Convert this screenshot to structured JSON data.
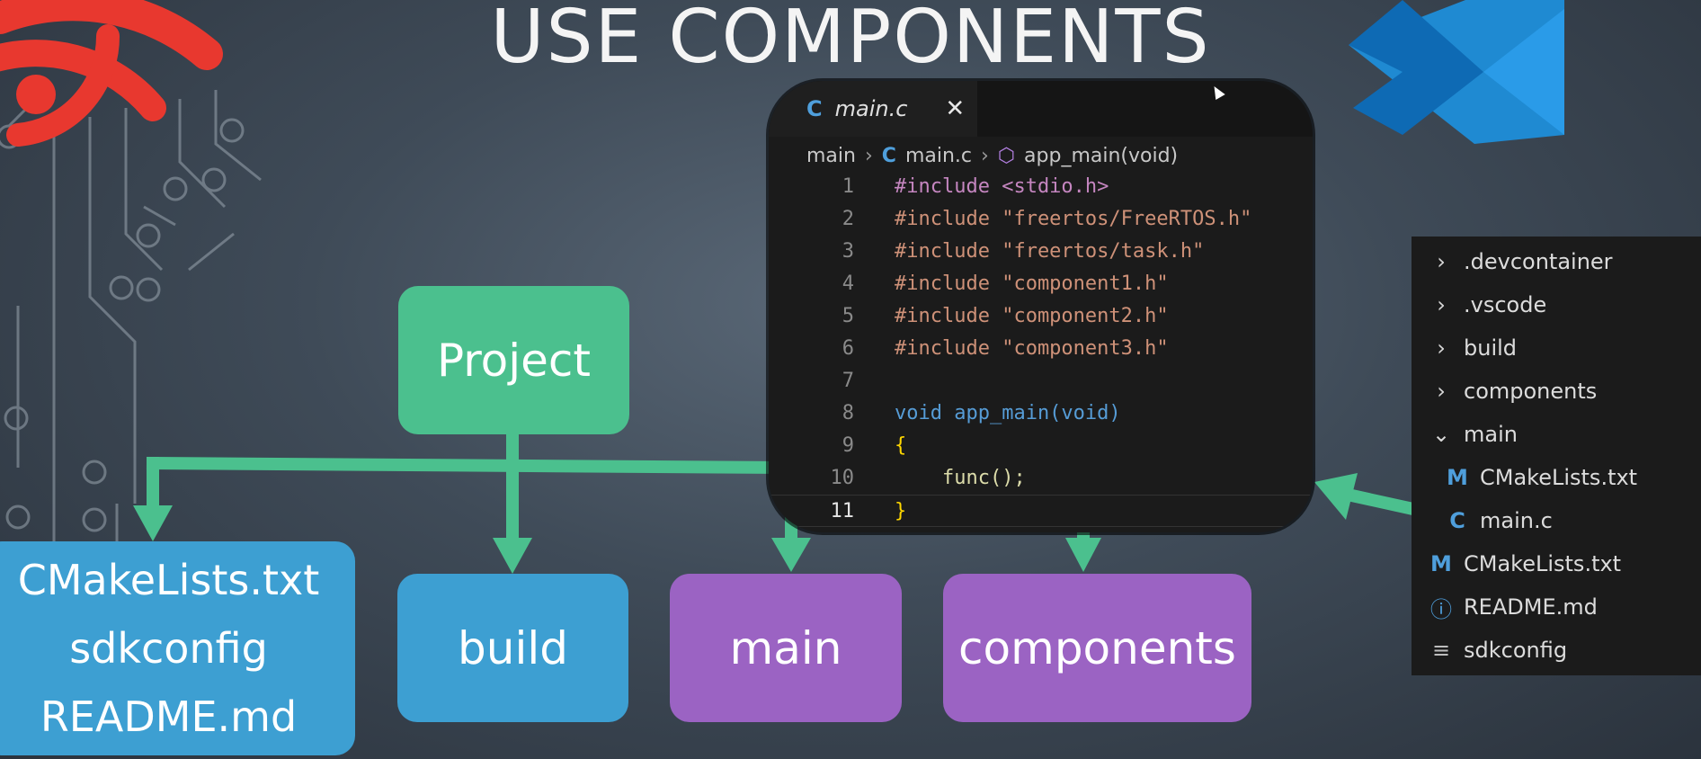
{
  "slide": {
    "title": "USE COMPONENTS"
  },
  "diagram": {
    "project": "Project",
    "root_files": [
      "CMakeLists.txt",
      "sdkconfig",
      "README.md"
    ],
    "build": "build",
    "main": "main",
    "components": "components"
  },
  "editor": {
    "tab": {
      "label": "main.c",
      "icon": "C"
    },
    "breadcrumb": {
      "folder": "main",
      "file": "main.c",
      "symbol": "app_main(void)"
    },
    "lines": [
      {
        "num": "1",
        "text": "#include <stdio.h>"
      },
      {
        "num": "2",
        "text": "#include \"freertos/FreeRTOS.h\""
      },
      {
        "num": "3",
        "text": "#include \"freertos/task.h\""
      },
      {
        "num": "4",
        "text": "#include \"component1.h\""
      },
      {
        "num": "5",
        "text": "#include \"component2.h\""
      },
      {
        "num": "6",
        "text": "#include \"component3.h\""
      },
      {
        "num": "7",
        "text": ""
      },
      {
        "num": "8",
        "text": "void app_main(void)"
      },
      {
        "num": "9",
        "text": "{"
      },
      {
        "num": "10",
        "text": "    func();"
      },
      {
        "num": "11",
        "text": "}"
      }
    ]
  },
  "explorer": {
    "items": [
      {
        "label": ".devcontainer",
        "icon": "chevron-right-icon"
      },
      {
        "label": ".vscode",
        "icon": "chevron-right-icon"
      },
      {
        "label": "build",
        "icon": "chevron-right-icon"
      },
      {
        "label": "components",
        "icon": "chevron-right-icon"
      },
      {
        "label": "main",
        "icon": "chevron-down-icon"
      },
      {
        "label": "CMakeLists.txt",
        "icon": "M"
      },
      {
        "label": "main.c",
        "icon": "C"
      },
      {
        "label": "CMakeLists.txt",
        "icon": "M"
      },
      {
        "label": "README.md",
        "icon": "info-icon"
      },
      {
        "label": "sdkconfig",
        "icon": "lines-icon"
      }
    ]
  },
  "colors": {
    "green": "#4bc08e",
    "blue": "#3d9fd2",
    "purple": "#9b63c3",
    "espressif_red": "#e8382f",
    "vscode_blue": "#1f8ad2"
  }
}
